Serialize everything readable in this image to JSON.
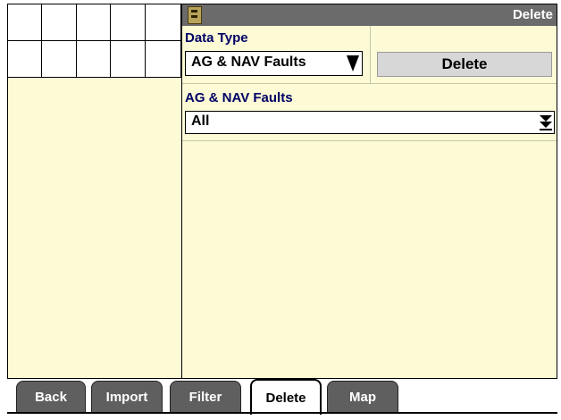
{
  "window": {
    "title": "Delete"
  },
  "data_type": {
    "label": "Data Type",
    "selected": "AG & NAV Faults"
  },
  "actions": {
    "delete_label": "Delete"
  },
  "faults": {
    "label": "AG & NAV Faults",
    "selected": "All"
  },
  "tabs": [
    {
      "label": "Back",
      "active": false
    },
    {
      "label": "Import",
      "active": false
    },
    {
      "label": "Filter",
      "active": false
    },
    {
      "label": "Delete",
      "active": true
    },
    {
      "label": "Map",
      "active": false
    }
  ],
  "colors": {
    "panel_bg": "#fcfbd6",
    "title_bar": "#6b6b6b",
    "label_text": "#000066",
    "tab_inactive": "#5f5f5f"
  },
  "icons": {
    "app": "data-manager-icon",
    "dropdown": "dropdown-arrow-icon"
  }
}
